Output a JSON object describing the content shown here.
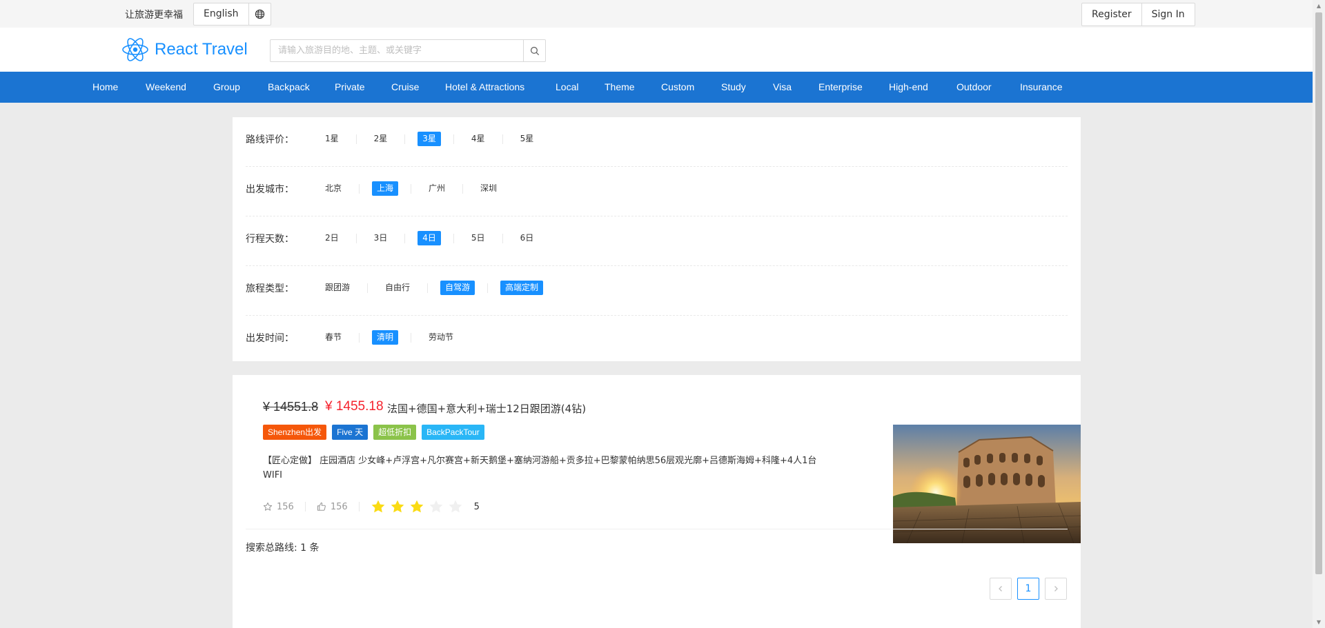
{
  "topbar": {
    "slogan": "让旅游更幸福",
    "language": "English",
    "register": "Register",
    "sign_in": "Sign In"
  },
  "header": {
    "brand": "React Travel",
    "search_placeholder": "请输入旅游目的地、主题、或关键字"
  },
  "nav": [
    "Home",
    "Weekend",
    "Group",
    "Backpack",
    "Private",
    "Cruise",
    "Hotel & Attractions",
    "Local",
    "Theme",
    "Custom",
    "Study",
    "Visa",
    "Enterprise",
    "High-end",
    "Outdoor",
    "Insurance"
  ],
  "filters": [
    {
      "title": "路线评价：",
      "options": [
        "1星",
        "2星",
        "3星",
        "4星",
        "5星"
      ],
      "active": [
        2
      ]
    },
    {
      "title": "出发城市：",
      "options": [
        "北京",
        "上海",
        "广州",
        "深圳"
      ],
      "active": [
        1
      ]
    },
    {
      "title": "行程天数：",
      "options": [
        "2日",
        "3日",
        "4日",
        "5日",
        "6日"
      ],
      "active": [
        2
      ]
    },
    {
      "title": "旅程类型：",
      "options": [
        "跟团游",
        "自由行",
        "自驾游",
        "高端定制"
      ],
      "active": [
        2,
        3
      ]
    },
    {
      "title": "出发时间：",
      "options": [
        "春节",
        "清明",
        "劳动节"
      ],
      "active": [
        1
      ]
    }
  ],
  "result": {
    "original_price": "¥ 14551.8",
    "price": "¥ 1455.18",
    "title": "法国+德国+意大利+瑞士12日跟团游(4钻)",
    "tags": [
      {
        "label": "Shenzhen出发",
        "color": "#f5570a"
      },
      {
        "label": "Five 天",
        "color": "#1b74d2"
      },
      {
        "label": "超低折扣",
        "color": "#8bc34a"
      },
      {
        "label": "BackPackTour",
        "color": "#29b6f6"
      }
    ],
    "description": "【匠心定做】 庄园酒店 少女峰+卢浮宫+凡尔赛宫+新天鹅堡+塞纳河游船+贡多拉+巴黎蒙帕纳思56层观光廓+吕德斯海姆+科隆+4人1台WIFI",
    "favorites": "156",
    "likes": "156",
    "rating": 3,
    "rating_label": "5",
    "image_alt": "Colosseum at sunrise"
  },
  "summary": "搜索总路线: 1 条",
  "pagination": {
    "current": "1"
  },
  "colors": {
    "primary": "#1890ff",
    "nav": "#1b74d2",
    "price": "#f5222d",
    "star": "#fadb14"
  }
}
